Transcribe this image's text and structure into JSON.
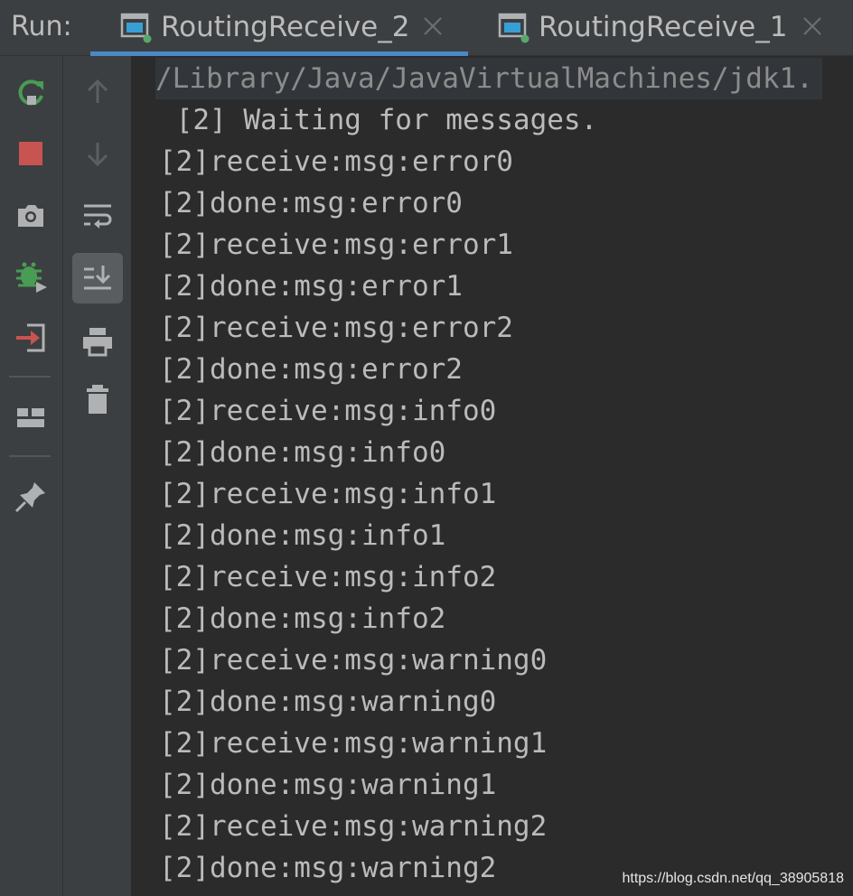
{
  "window": {
    "run_label": "Run:"
  },
  "tabs": [
    {
      "label": "RoutingReceive_2",
      "active": true,
      "icon": "console-run-icon"
    },
    {
      "label": "RoutingReceive_1",
      "active": false,
      "icon": "console-run-icon"
    }
  ],
  "toolbar_left": [
    {
      "name": "rerun-icon",
      "color": "#499c54"
    },
    {
      "name": "stop-icon",
      "color": "#c75450"
    },
    {
      "name": "camera-icon",
      "color": "#afb1b3"
    },
    {
      "name": "debug-icon",
      "color": "#499c54"
    },
    {
      "name": "exit-icon",
      "color": "#c75450"
    },
    {
      "name": "layout-icon",
      "color": "#afb1b3"
    },
    {
      "name": "pin-icon",
      "color": "#afb1b3"
    }
  ],
  "toolbar_right": [
    {
      "name": "arrow-up-icon",
      "enabled": false
    },
    {
      "name": "arrow-down-icon",
      "enabled": false
    },
    {
      "name": "soft-wrap-icon",
      "enabled": true
    },
    {
      "name": "scroll-to-end-icon",
      "enabled": true,
      "active": true
    },
    {
      "name": "print-icon",
      "enabled": true
    },
    {
      "name": "trash-icon",
      "enabled": true
    }
  ],
  "console": {
    "command": "/Library/Java/JavaVirtualMachines/jdk1.",
    "lines": [
      " [2] Waiting for messages.",
      "[2]receive:msg:error0",
      "[2]done:msg:error0",
      "[2]receive:msg:error1",
      "[2]done:msg:error1",
      "[2]receive:msg:error2",
      "[2]done:msg:error2",
      "[2]receive:msg:info0",
      "[2]done:msg:info0",
      "[2]receive:msg:info1",
      "[2]done:msg:info1",
      "[2]receive:msg:info2",
      "[2]done:msg:info2",
      "[2]receive:msg:warning0",
      "[2]done:msg:warning0",
      "[2]receive:msg:warning1",
      "[2]done:msg:warning1",
      "[2]receive:msg:warning2",
      "[2]done:msg:warning2"
    ]
  },
  "watermark": "https://blog.csdn.net/qq_38905818",
  "colors": {
    "background": "#2b2b2b",
    "toolbar": "#3c3f41",
    "text": "#bbbbbb",
    "accent": "#4a88c7",
    "running": "#59a869"
  }
}
